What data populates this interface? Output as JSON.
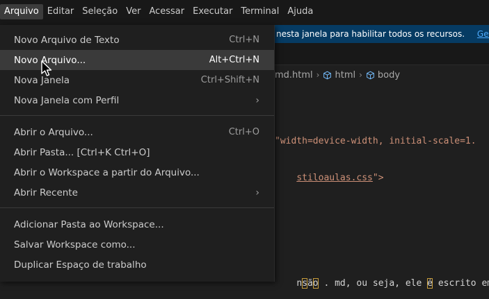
{
  "menubar": {
    "items": [
      "Arquivo",
      "Editar",
      "Seleção",
      "Ver",
      "Acessar",
      "Executar",
      "Terminal",
      "Ajuda"
    ]
  },
  "infobar": {
    "message": "nesta janela para habilitar todos os recursos.",
    "link": "Gerenciar"
  },
  "breadcrumb": {
    "file": "md.html",
    "html": "html",
    "body": "body"
  },
  "editor": {
    "line1": "\"width=device-width, initial-scale=1.",
    "line2_link": "stiloaulas.css",
    "line2_end": "\">",
    "line3_a": "nsão",
    "line3_b": " . md, ou seja, ele ",
    "line3_c": "é",
    "line3_d": " escrito em"
  },
  "file_menu": {
    "items": [
      {
        "label": "Novo Arquivo de Texto",
        "shortcut": "Ctrl+N"
      },
      {
        "label": "Novo Arquivo...",
        "shortcut": "Alt+Ctrl+N"
      },
      {
        "label": "Nova Janela",
        "shortcut": "Ctrl+Shift+N"
      },
      {
        "label": "Nova Janela com Perfil",
        "shortcut": "›"
      },
      {
        "label": "Abrir o Arquivo...",
        "shortcut": "Ctrl+O"
      },
      {
        "label": "Abrir Pasta... [Ctrl+K Ctrl+O]",
        "shortcut": ""
      },
      {
        "label": "Abrir o Workspace a partir do Arquivo...",
        "shortcut": ""
      },
      {
        "label": "Abrir Recente",
        "shortcut": "›"
      },
      {
        "label": "Adicionar Pasta ao Workspace...",
        "shortcut": ""
      },
      {
        "label": "Salvar Workspace como...",
        "shortcut": ""
      },
      {
        "label": "Duplicar Espaço de trabalho",
        "shortcut": ""
      }
    ]
  },
  "colors": {
    "menu_bg": "#1f1f1f",
    "hover_bg": "#3a3a3a",
    "infobar_bg": "#063b63",
    "accent_link": "#4daafc",
    "string": "#ce9178"
  }
}
